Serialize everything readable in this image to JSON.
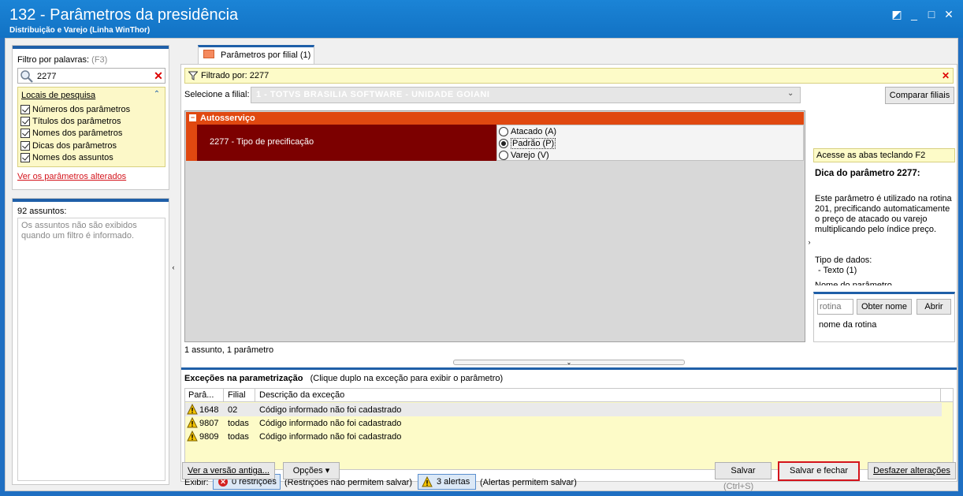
{
  "window": {
    "title": "132 - Parâmetros da presidência",
    "subtitle": "Distribuição e Varejo (Linha WinThor)",
    "controls": {
      "restore": "◩",
      "minimize": "_",
      "maximize": "□",
      "close": "✕"
    }
  },
  "left": {
    "filter_label": "Filtro por palavras:",
    "filter_hint": "(F3)",
    "search_value": "2277",
    "locais_title": "Locais de pesquisa",
    "locais_items": [
      "Números dos parâmetros",
      "Títulos dos parâmetros",
      "Nomes dos parâmetros",
      "Dicas dos parâmetros",
      "Nomes dos assuntos"
    ],
    "ver_alterados": "Ver os parâmetros alterados",
    "assuntos_label": "92 assuntos:",
    "assuntos_msg": "Os assuntos não são exibidos quando um filtro é informado."
  },
  "tab": {
    "label": "Parâmetros por filial  (1)"
  },
  "filter_bar": {
    "text": "Filtrado por: 2277"
  },
  "filial": {
    "label": "Selecione a filial:",
    "value": "1 - TOTVS BRASILIA SOFTWARE - UNIDADE GOIANI",
    "compare_button": "Comparar filiais"
  },
  "grid": {
    "group_title": "Autosserviço",
    "param_name": "2277 - Tipo de precificação",
    "options": [
      "Atacado (A)",
      "Padrão (P)",
      "Varejo (V)"
    ],
    "selected_option": "Padrão (P)",
    "status": "1 assunto, 1 parâmetro"
  },
  "side": {
    "f2_hint": "Acesse as abas teclando F2",
    "dica_title": "Dica do parâmetro 2277:",
    "dica_text": "Este parâmetro é utilizado na rotina 201, precificando automaticamente o preço de atacado ou varejo multiplicando pelo índice preço.",
    "tipo_label": "Tipo de dados:",
    "tipo_value": "- Texto (1)",
    "nome_cut": "Nome do parâmetro",
    "rotina_placeholder": "rotina",
    "obter_nome_button": "Obter nome",
    "abrir_button": "Abrir",
    "nome_rotina": "nome da rotina"
  },
  "exceptions": {
    "title": "Exceções na parametrização",
    "hint": "(Clique duplo na exceção para exibir o parâmetro)",
    "headers": [
      "Parâ...",
      "Filial",
      "Descrição da exceção"
    ],
    "rows": [
      {
        "param": "1648",
        "filial": "02",
        "desc": "Código informado não foi cadastrado"
      },
      {
        "param": "9807",
        "filial": "todas",
        "desc": "Código informado não foi cadastrado"
      },
      {
        "param": "9809",
        "filial": "todas",
        "desc": "Código informado não foi cadastrado"
      }
    ],
    "exibir_label": "Exibir:",
    "restricoes_button": "0 restrições",
    "restricoes_desc": "(Restrições não permitem salvar)",
    "alertas_button": "3 alertas",
    "alertas_desc": "(Alertas permitem salvar)"
  },
  "footer": {
    "versao_button": "Ver a versão antiga...",
    "opcoes_button": "Opções ▾",
    "salvar_button": "Salvar",
    "salvar_shortcut": "(Ctrl+S)",
    "salvar_fechar_button": "Salvar e fechar",
    "desfazer_button": "Desfazer alterações"
  },
  "colors": {
    "title_bar": "#1b84d6",
    "group_header": "#e04810",
    "param_cell": "#7c0000",
    "highlight_border": "#d4141c",
    "hint_yellow": "#fdfbc8"
  }
}
